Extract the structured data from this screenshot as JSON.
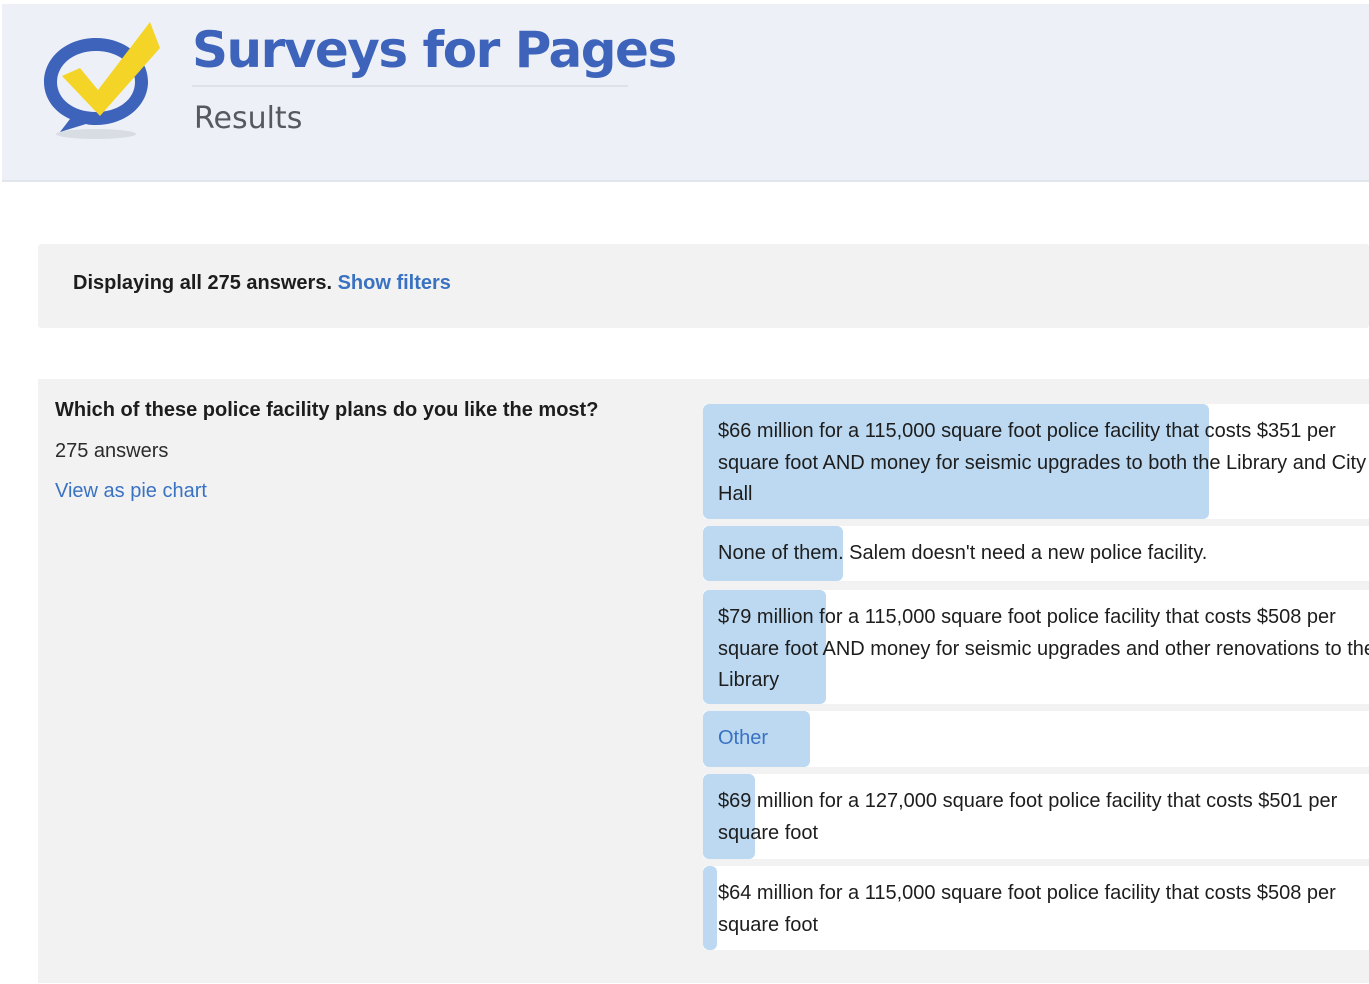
{
  "header": {
    "title": "Surveys for Pages",
    "subtitle": "Results",
    "logo_icon": "speech-bubble-checkmark-icon",
    "colors": {
      "brand_blue": "#3d63bb",
      "check_yellow": "#f4d426",
      "header_bg": "#edf1f7"
    }
  },
  "filter_bar": {
    "text": "Displaying all 275 answers.",
    "link": "Show filters"
  },
  "question": {
    "title": "Which of these police facility plans do you like the most?",
    "count_label": "275 answers",
    "view_link": "View as pie chart",
    "answers": [
      {
        "text": "$66 million for a 115,000 square foot police facility that costs $351 per square foot AND money for seismic upgrades to both the Library and City Hall",
        "share": 0.76
      },
      {
        "text": "None of them. Salem doesn't need a new police facility.",
        "share": 0.21
      },
      {
        "text": "$79 million for a 115,000 square foot police facility that costs $508 per square foot AND money for seismic upgrades and other renovations to the Library",
        "share": 0.185
      },
      {
        "text": "Other",
        "share": 0.16
      },
      {
        "text": "$69 million for a 127,000 square foot police facility that costs $501 per square foot",
        "share": 0.078
      },
      {
        "text": "$64 million for a 115,000 square foot police facility that costs $508 per square foot",
        "share": 0.021
      }
    ],
    "bar_color": "#bcd9f1"
  }
}
